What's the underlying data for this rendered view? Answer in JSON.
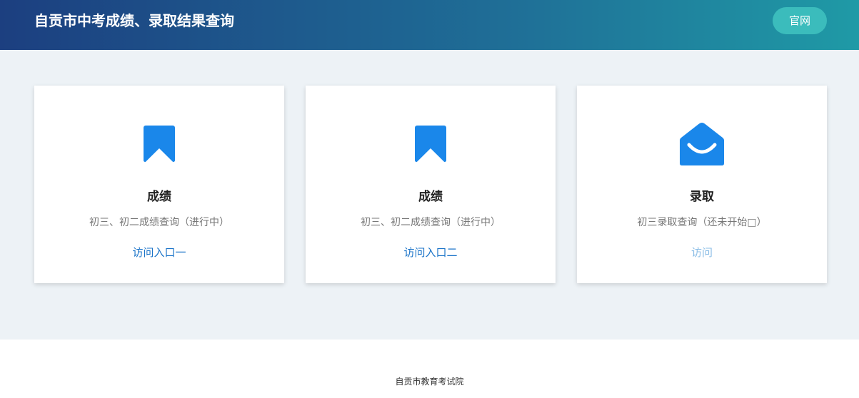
{
  "header": {
    "title": "自贡市中考成绩、录取结果查询",
    "site_button": "官网"
  },
  "cards": [
    {
      "icon": "bookmark-icon",
      "title": "成绩",
      "desc": "初三、初二成绩查询（进行中）",
      "link": "访问入口一"
    },
    {
      "icon": "bookmark-icon",
      "title": "成绩",
      "desc": "初三、初二成绩查询（进行中）",
      "link": "访问入口二"
    },
    {
      "icon": "open-envelope-icon",
      "title": "录取",
      "desc": "初三录取查询（还未开始□）",
      "link": "访问"
    }
  ],
  "footer": {
    "text": "自贡市教育考试院"
  },
  "colors": {
    "accent": "#1a87ea",
    "link": "#1a73c8",
    "link_disabled": "#8bbde6",
    "header_start": "#1c3f80",
    "header_end": "#1f9aa6",
    "button": "#3bbcbc"
  }
}
